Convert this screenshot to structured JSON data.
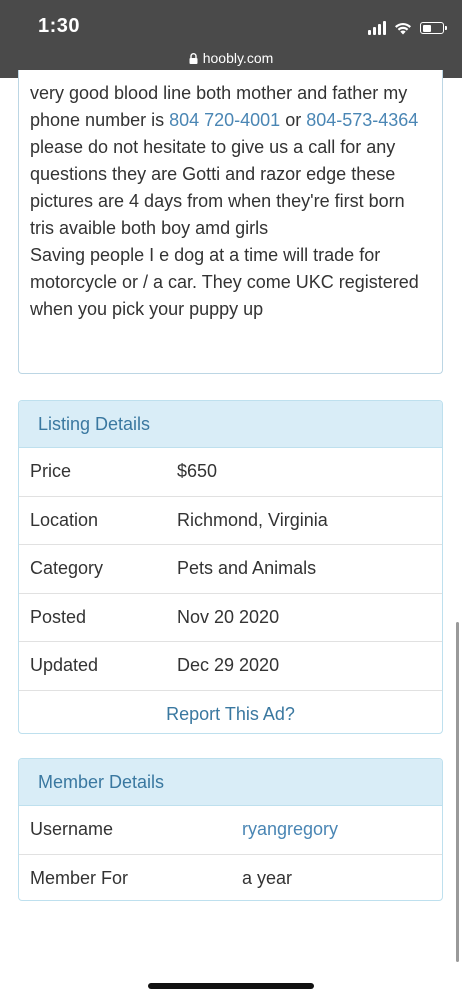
{
  "status_bar": {
    "time": "1:30",
    "url": "hoobly.com",
    "icons": [
      "signal-icon",
      "wifi-icon",
      "battery-icon",
      "lock-icon"
    ]
  },
  "description": {
    "line1": "very good blood line both mother and father my phone number is ",
    "phone1": "804 720-4001",
    "or": " or ",
    "phone2": "804-573-4364",
    "line2": " please do not hesitate to give us a call for any questions they are Gotti and razor edge these pictures are 4 days from when they're first born tris avaible both boy amd girls",
    "line3": "Saving people I e dog at a time will trade for motorcycle or / a car. They come UKC registered when you pick your puppy up"
  },
  "listing_details": {
    "heading": "Listing Details",
    "rows": [
      {
        "label": "Price",
        "value": "$650"
      },
      {
        "label": "Location",
        "value": "Richmond, Virginia"
      },
      {
        "label": "Category",
        "value": "Pets and Animals"
      },
      {
        "label": "Posted",
        "value": "Nov 20 2020"
      },
      {
        "label": "Updated",
        "value": "Dec 29 2020"
      }
    ],
    "report_link": "Report This Ad?"
  },
  "member_details": {
    "heading": "Member Details",
    "rows": [
      {
        "label": "Username",
        "value": "ryangregory"
      },
      {
        "label": "Member For",
        "value": "a year"
      }
    ]
  },
  "colors": {
    "status_bar_bg": "#4a4a4a",
    "link": "#4a86b4",
    "panel_heading_bg": "#d9edf7",
    "panel_heading_text": "#3a78a0"
  }
}
